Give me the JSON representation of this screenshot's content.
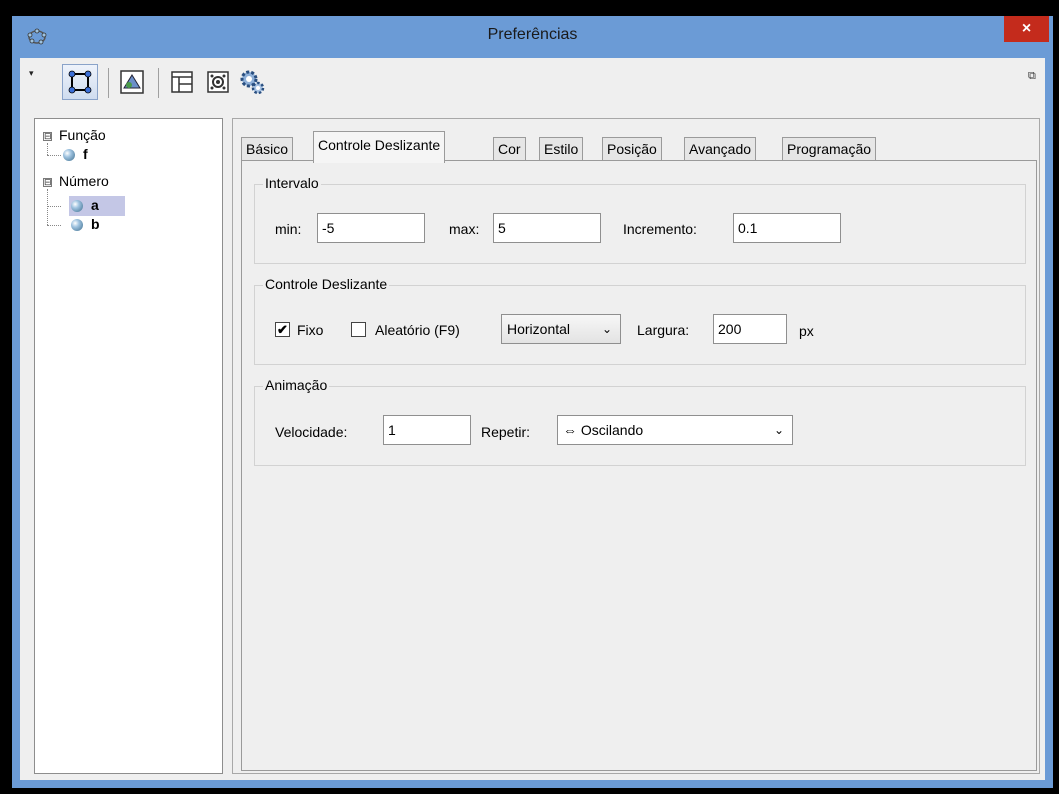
{
  "window": {
    "title": "Preferências",
    "close_glyph": "×"
  },
  "toolbar": {
    "menu_arrow": "▾",
    "undock_glyph": "⧉",
    "icons": [
      "object-properties-icon",
      "graphics-icon",
      "layout-icon",
      "defaults-icon",
      "advanced-settings-icon"
    ]
  },
  "tree": {
    "groups": [
      {
        "label": "Função",
        "toggle": "⊟",
        "items": [
          "f"
        ]
      },
      {
        "label": "Número",
        "toggle": "⊟",
        "items": [
          "a",
          "b"
        ]
      }
    ],
    "selected_item": "a"
  },
  "tabs": [
    "Básico",
    "Controle Deslizante",
    "Cor",
    "Estilo",
    "Posição",
    "Avançado",
    "Programação"
  ],
  "active_tab": "Controle Deslizante",
  "intervalo": {
    "title": "Intervalo",
    "min_label": "min:",
    "min_value": "-5",
    "max_label": "max:",
    "max_value": "5",
    "inc_label": "Incremento:",
    "inc_value": "0.1"
  },
  "slider": {
    "title": "Controle Deslizante",
    "fixo_label": "Fixo",
    "fixo_checked": true,
    "check_glyph": "✔",
    "aleatorio_label": "Aleatório (F9)",
    "aleatorio_checked": false,
    "orientation": "Horizontal",
    "width_label": "Largura:",
    "width_value": "200",
    "width_unit": "px"
  },
  "animacao": {
    "title": "Animação",
    "speed_label": "Velocidade:",
    "speed_value": "1",
    "repeat_label": "Repetir:",
    "repeat_value": "⇔ Oscilando"
  },
  "colors": {
    "titlebar": "#6b9bd6",
    "close": "#c42b1c",
    "selection": "#c4c7e6",
    "panel": "#efefef"
  }
}
